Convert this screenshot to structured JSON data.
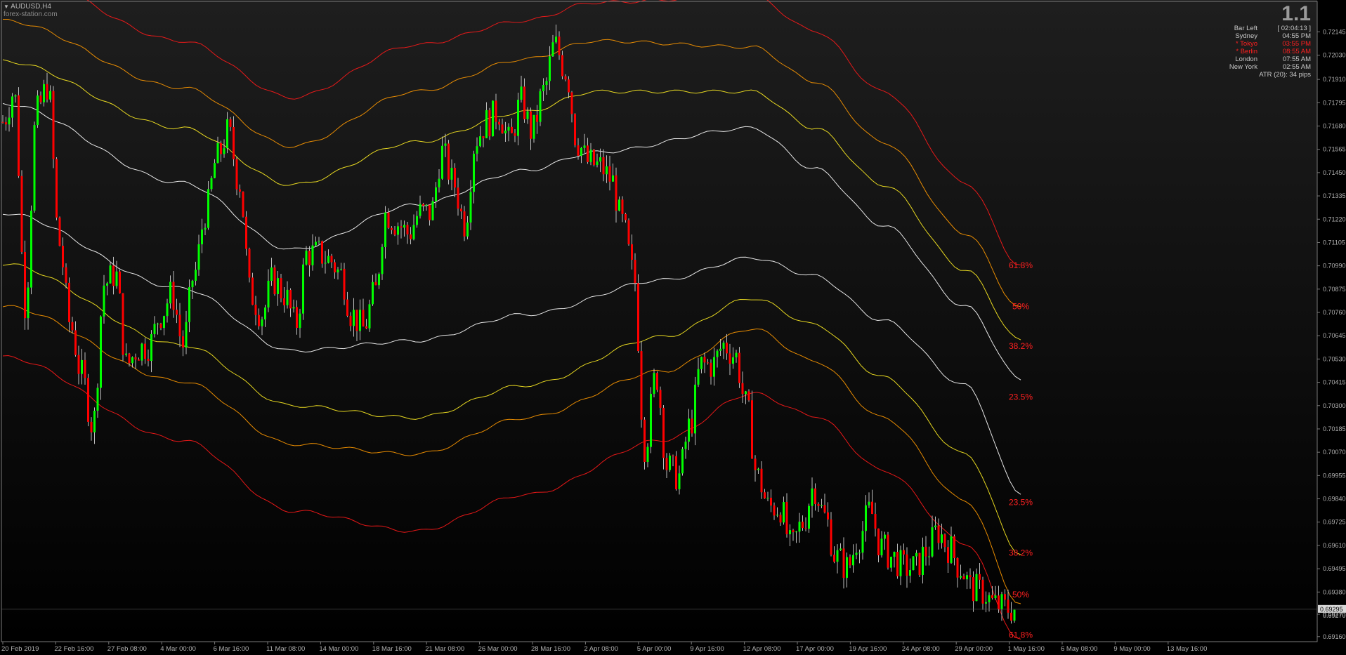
{
  "header": {
    "symbol": "AUDUSD,H4",
    "watermark": "forex-station.com"
  },
  "info_panel": {
    "big_value": "1.1",
    "rows": [
      {
        "label": "Bar Left",
        "value": "[ 02:04:13 ]",
        "color": "#c8c8c8"
      },
      {
        "label": "Sydney",
        "value": "04:55 PM",
        "color": "#c8c8c8"
      },
      {
        "label": "* Tokyo",
        "value": "03:55 PM",
        "color": "#ff2020"
      },
      {
        "label": "* Berlin",
        "value": "08:55 AM",
        "color": "#ff2020"
      },
      {
        "label": "London",
        "value": "07:55 AM",
        "color": "#c8c8c8"
      },
      {
        "label": "New York",
        "value": "02:55 AM",
        "color": "#c8c8c8"
      }
    ],
    "atr": "ATR (20): 34 pips"
  },
  "colors": {
    "bull": "#00ff00",
    "bear": "#ff0000",
    "axis_text": "#b0b0b0",
    "band_outer": "#ff1a1a",
    "band_orange": "#ff9900",
    "band_yellow": "#ffee22",
    "band_white": "#ffffff",
    "fib_label": "#ff2020",
    "background_top": "#1e1e1e",
    "background_bottom": "#000000"
  },
  "chart_data": {
    "type": "candlestick",
    "y_ticks": [
      "0.72145",
      "0.72030",
      "0.71910",
      "0.71795",
      "0.71680",
      "0.71565",
      "0.71450",
      "0.71335",
      "0.71220",
      "0.71105",
      "0.70990",
      "0.70875",
      "0.70760",
      "0.70645",
      "0.70530",
      "0.70415",
      "0.70300",
      "0.70185",
      "0.70070",
      "0.69955",
      "0.69840",
      "0.69725",
      "0.69610",
      "0.69495",
      "0.69380",
      "0.69270",
      "0.69160"
    ],
    "ylim": [
      0.69135,
      0.72295
    ],
    "x_ticks": [
      "20 Feb 2019",
      "22 Feb 16:00",
      "27 Feb 08:00",
      "4 Mar 00:00",
      "6 Mar 16:00",
      "11 Mar 08:00",
      "14 Mar 00:00",
      "18 Mar 16:00",
      "21 Mar 08:00",
      "26 Mar 00:00",
      "28 Mar 16:00",
      "2 Apr 08:00",
      "5 Apr 00:00",
      "9 Apr 16:00",
      "12 Apr 08:00",
      "17 Apr 00:00",
      "19 Apr 16:00",
      "24 Apr 08:00",
      "29 Apr 00:00",
      "1 May 16:00",
      "6 May 08:00",
      "9 May 00:00",
      "13 May 16:00"
    ],
    "current_price": "0.69295",
    "price_marker": "0.69270",
    "close_path": [
      [
        0,
        0.717
      ],
      [
        10,
        0.7185
      ],
      [
        20,
        0.708
      ],
      [
        30,
        0.7175
      ],
      [
        40,
        0.7188
      ],
      [
        50,
        0.711
      ],
      [
        60,
        0.707
      ],
      [
        70,
        0.7045
      ],
      [
        80,
        0.702
      ],
      [
        90,
        0.709
      ],
      [
        100,
        0.7095
      ],
      [
        110,
        0.705
      ],
      [
        120,
        0.7058
      ],
      [
        130,
        0.706
      ],
      [
        140,
        0.7075
      ],
      [
        150,
        0.7085
      ],
      [
        160,
        0.706
      ],
      [
        170,
        0.7095
      ],
      [
        180,
        0.7125
      ],
      [
        190,
        0.7152
      ],
      [
        200,
        0.7165
      ],
      [
        210,
        0.714
      ],
      [
        220,
        0.7085
      ],
      [
        230,
        0.7075
      ],
      [
        240,
        0.7092
      ],
      [
        250,
        0.7085
      ],
      [
        260,
        0.707
      ],
      [
        270,
        0.7105
      ],
      [
        280,
        0.7105
      ],
      [
        290,
        0.7102
      ],
      [
        300,
        0.7095
      ],
      [
        310,
        0.7075
      ],
      [
        320,
        0.7068
      ],
      [
        330,
        0.7085
      ],
      [
        340,
        0.7125
      ],
      [
        350,
        0.712
      ],
      [
        360,
        0.7115
      ],
      [
        370,
        0.7125
      ],
      [
        380,
        0.7125
      ],
      [
        390,
        0.7155
      ],
      [
        400,
        0.714
      ],
      [
        410,
        0.712
      ],
      [
        420,
        0.7162
      ],
      [
        430,
        0.717
      ],
      [
        440,
        0.7175
      ],
      [
        450,
        0.716
      ],
      [
        460,
        0.718
      ],
      [
        470,
        0.7165
      ],
      [
        480,
        0.7185
      ],
      [
        490,
        0.7208
      ],
      [
        500,
        0.7195
      ],
      [
        510,
        0.716
      ],
      [
        520,
        0.715
      ],
      [
        530,
        0.7148
      ],
      [
        540,
        0.7142
      ],
      [
        550,
        0.712
      ],
      [
        560,
        0.7095
      ],
      [
        570,
        0.701
      ],
      [
        580,
        0.7045
      ],
      [
        590,
        0.7
      ],
      [
        600,
        0.6995
      ],
      [
        610,
        0.702
      ],
      [
        620,
        0.705
      ],
      [
        630,
        0.705
      ],
      [
        640,
        0.706
      ],
      [
        650,
        0.7055
      ],
      [
        660,
        0.703
      ],
      [
        670,
        0.6995
      ],
      [
        680,
        0.698
      ],
      [
        690,
        0.698
      ],
      [
        700,
        0.696
      ],
      [
        710,
        0.6972
      ],
      [
        720,
        0.699
      ],
      [
        730,
        0.6975
      ],
      [
        740,
        0.6955
      ],
      [
        750,
        0.695
      ],
      [
        760,
        0.6965
      ],
      [
        770,
        0.6978
      ],
      [
        780,
        0.696
      ],
      [
        790,
        0.6955
      ],
      [
        800,
        0.695
      ],
      [
        810,
        0.695
      ],
      [
        820,
        0.6958
      ],
      [
        830,
        0.6968
      ],
      [
        840,
        0.696
      ],
      [
        850,
        0.695
      ],
      [
        860,
        0.694
      ],
      [
        870,
        0.6938
      ],
      [
        880,
        0.6932
      ],
      [
        890,
        0.693
      ],
      [
        900,
        0.69295
      ]
    ],
    "upper_bands": [
      {
        "name": "outer",
        "color_key": "band_outer",
        "points": [
          [
            0,
            0.7246
          ],
          [
            130,
            0.721
          ],
          [
            210,
            0.7182
          ],
          [
            300,
            0.7208
          ],
          [
            380,
            0.722
          ],
          [
            430,
            0.7229
          ],
          [
            545,
            0.7232
          ],
          [
            590,
            0.7215
          ],
          [
            640,
            0.7185
          ],
          [
            700,
            0.714
          ],
          [
            740,
            0.7099
          ]
        ]
      },
      {
        "name": "orange",
        "color_key": "band_orange",
        "points": [
          [
            0,
            0.722
          ],
          [
            130,
            0.7187
          ],
          [
            210,
            0.7158
          ],
          [
            300,
            0.7185
          ],
          [
            380,
            0.7201
          ],
          [
            430,
            0.721
          ],
          [
            545,
            0.7207
          ],
          [
            590,
            0.719
          ],
          [
            640,
            0.716
          ],
          [
            700,
            0.7115
          ],
          [
            740,
            0.7078
          ]
        ]
      },
      {
        "name": "yellow",
        "color_key": "band_yellow",
        "points": [
          [
            0,
            0.72
          ],
          [
            130,
            0.7167
          ],
          [
            210,
            0.7139
          ],
          [
            300,
            0.716
          ],
          [
            380,
            0.7175
          ],
          [
            430,
            0.7185
          ],
          [
            545,
            0.7185
          ],
          [
            590,
            0.7167
          ],
          [
            640,
            0.7139
          ],
          [
            700,
            0.7097
          ],
          [
            740,
            0.7062
          ]
        ]
      },
      {
        "name": "white",
        "color_key": "band_white",
        "points": [
          [
            0,
            0.7179
          ],
          [
            130,
            0.714
          ],
          [
            210,
            0.7107
          ],
          [
            300,
            0.7129
          ],
          [
            380,
            0.7146
          ],
          [
            430,
            0.7155
          ],
          [
            545,
            0.7167
          ],
          [
            590,
            0.7147
          ],
          [
            640,
            0.7119
          ],
          [
            700,
            0.7079
          ],
          [
            740,
            0.7043
          ]
        ]
      }
    ],
    "lower_bands": [
      {
        "name": "white",
        "color_key": "band_white",
        "points": [
          [
            0,
            0.7125
          ],
          [
            130,
            0.7088
          ],
          [
            210,
            0.7057
          ],
          [
            300,
            0.7062
          ],
          [
            380,
            0.7075
          ],
          [
            480,
            0.7092
          ],
          [
            545,
            0.7103
          ],
          [
            590,
            0.7094
          ],
          [
            640,
            0.7072
          ],
          [
            700,
            0.704
          ],
          [
            740,
            0.6987
          ]
        ]
      },
      {
        "name": "yellow",
        "color_key": "band_yellow",
        "points": [
          [
            0,
            0.71
          ],
          [
            130,
            0.706
          ],
          [
            210,
            0.703
          ],
          [
            300,
            0.7024
          ],
          [
            380,
            0.704
          ],
          [
            480,
            0.7064
          ],
          [
            545,
            0.7083
          ],
          [
            590,
            0.707
          ],
          [
            640,
            0.7044
          ],
          [
            700,
            0.7006
          ],
          [
            740,
            0.6957
          ]
        ]
      },
      {
        "name": "orange",
        "color_key": "band_orange",
        "points": [
          [
            0,
            0.7079
          ],
          [
            130,
            0.7042
          ],
          [
            210,
            0.7011
          ],
          [
            300,
            0.7006
          ],
          [
            380,
            0.7024
          ],
          [
            480,
            0.7047
          ],
          [
            545,
            0.7068
          ],
          [
            590,
            0.7052
          ],
          [
            640,
            0.7024
          ],
          [
            700,
            0.6983
          ],
          [
            740,
            0.6932
          ]
        ]
      },
      {
        "name": "outer",
        "color_key": "band_outer",
        "points": [
          [
            0,
            0.7054
          ],
          [
            130,
            0.7013
          ],
          [
            210,
            0.6978
          ],
          [
            300,
            0.6968
          ],
          [
            380,
            0.6986
          ],
          [
            480,
            0.7013
          ],
          [
            545,
            0.7036
          ],
          [
            590,
            0.7025
          ],
          [
            640,
            0.6998
          ],
          [
            700,
            0.6962
          ],
          [
            740,
            0.6914
          ]
        ]
      }
    ],
    "fib_labels_upper": [
      {
        "text": "61.8%",
        "price": 0.70992
      },
      {
        "text": "50%",
        "price": 0.7079
      },
      {
        "text": "38.2%",
        "price": 0.70593
      },
      {
        "text": "23.5%",
        "price": 0.70343
      }
    ],
    "fib_labels_lower": [
      {
        "text": "23.5%",
        "price": 0.69822
      },
      {
        "text": "38.2%",
        "price": 0.69573
      },
      {
        "text": "50%",
        "price": 0.69368
      },
      {
        "text": "61.8%",
        "price": 0.69168
      }
    ]
  }
}
